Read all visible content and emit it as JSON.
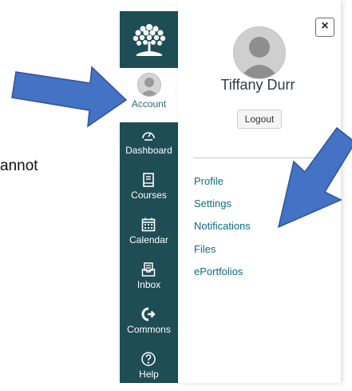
{
  "background_text": "annot",
  "nav": {
    "account_label": "Account",
    "items": [
      {
        "label": "Dashboard",
        "icon": "dashboard-icon"
      },
      {
        "label": "Courses",
        "icon": "courses-icon"
      },
      {
        "label": "Calendar",
        "icon": "calendar-icon"
      },
      {
        "label": "Inbox",
        "icon": "inbox-icon"
      },
      {
        "label": "Commons",
        "icon": "commons-icon"
      },
      {
        "label": "Help",
        "icon": "help-icon"
      }
    ]
  },
  "tray": {
    "close_label": "×",
    "user_name": "Tiffany Durr",
    "logout_label": "Logout",
    "links": [
      "Profile",
      "Settings",
      "Notifications",
      "Files",
      "ePortfolios"
    ]
  },
  "colors": {
    "nav_bg": "#1e4d55",
    "link": "#0e6c80",
    "arrow_fill": "#4472c4",
    "arrow_stroke": "#2f5597"
  }
}
